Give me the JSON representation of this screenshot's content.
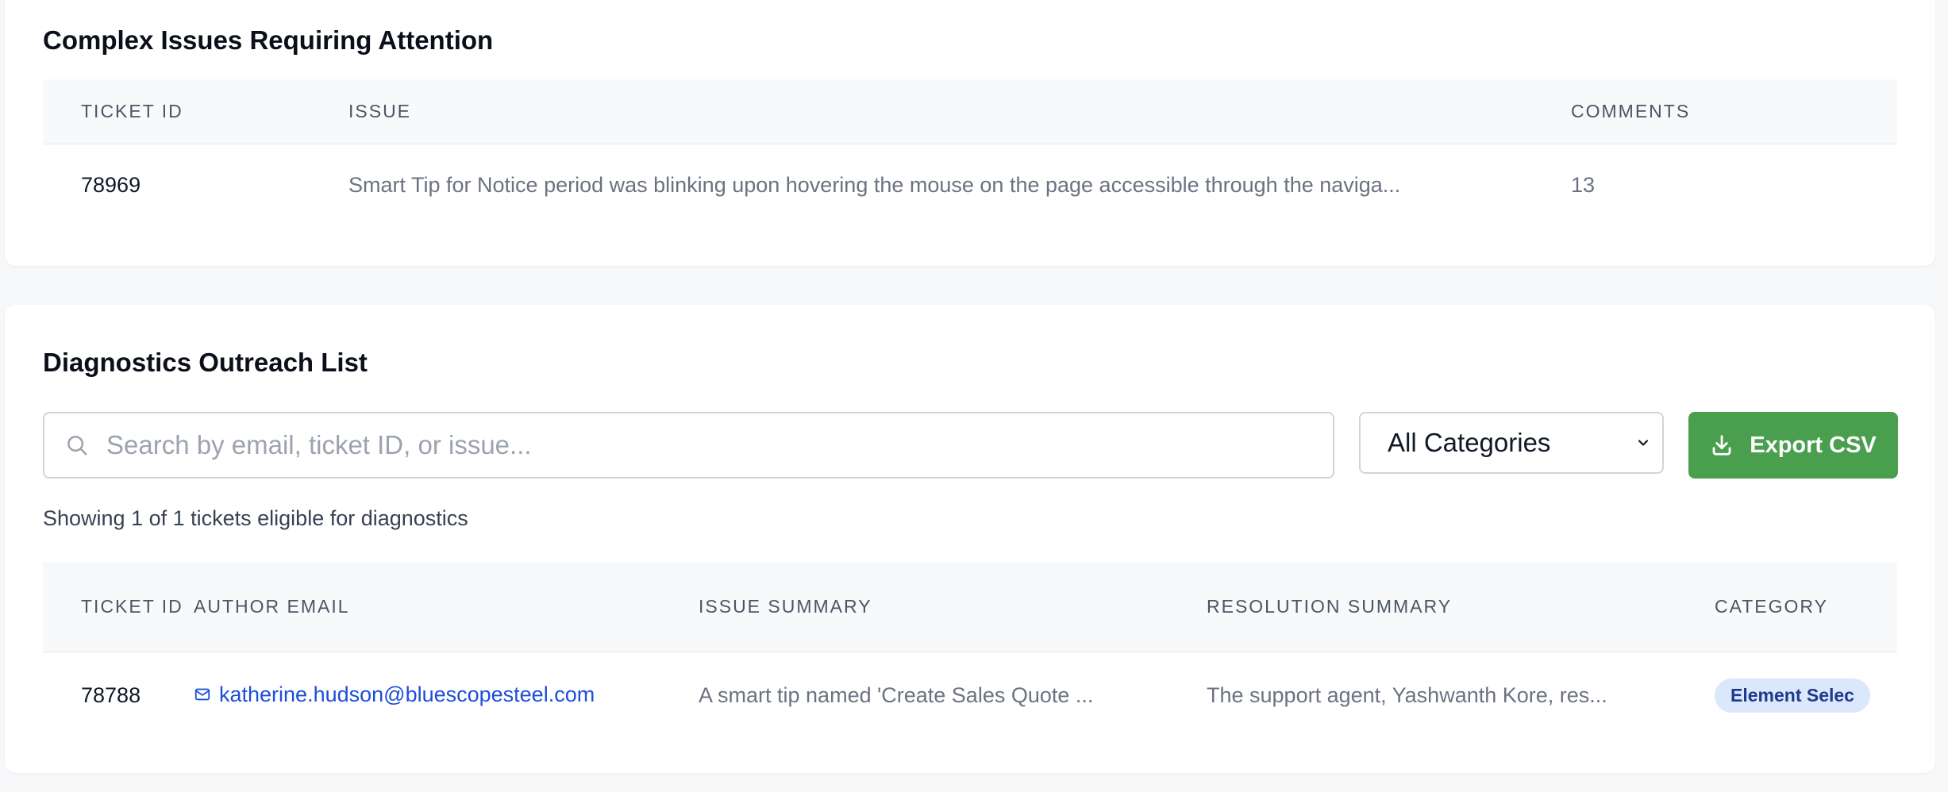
{
  "complex": {
    "title": "Complex Issues Requiring Attention",
    "columns": {
      "ticket_id": "TICKET ID",
      "issue": "ISSUE",
      "comments": "COMMENTS"
    },
    "rows": [
      {
        "ticket_id": "78969",
        "issue": "Smart Tip for Notice period was blinking upon hovering the mouse on the page accessible through the naviga...",
        "comments": "13"
      }
    ]
  },
  "diagnostics": {
    "title": "Diagnostics Outreach List",
    "search": {
      "placeholder": "Search by email, ticket ID, or issue...",
      "value": ""
    },
    "category_select": {
      "selected": "All Categories"
    },
    "export_label": "Export CSV",
    "showing_text": "Showing 1 of 1 tickets eligible for diagnostics",
    "columns": {
      "ticket_id": "TICKET ID",
      "author_email": "AUTHOR EMAIL",
      "issue_summary": "ISSUE SUMMARY",
      "resolution_summary": "RESOLUTION SUMMARY",
      "category": "CATEGORY"
    },
    "rows": [
      {
        "ticket_id": "78788",
        "author_email": "katherine.hudson@bluescopesteel.com",
        "issue_summary": "A smart tip named 'Create Sales Quote ...",
        "resolution_summary": "The support agent, Yashwanth Kore, res...",
        "category": "Element Selec"
      }
    ]
  },
  "colors": {
    "accent_green": "#4a9f4f",
    "link_blue": "#1d4ed8",
    "badge_bg": "#dbe8fb",
    "badge_text": "#1e3a8a"
  },
  "icons": {
    "search": "search-icon",
    "dropdown": "chevron-down-icon",
    "export": "download-icon",
    "email": "mail-icon"
  }
}
